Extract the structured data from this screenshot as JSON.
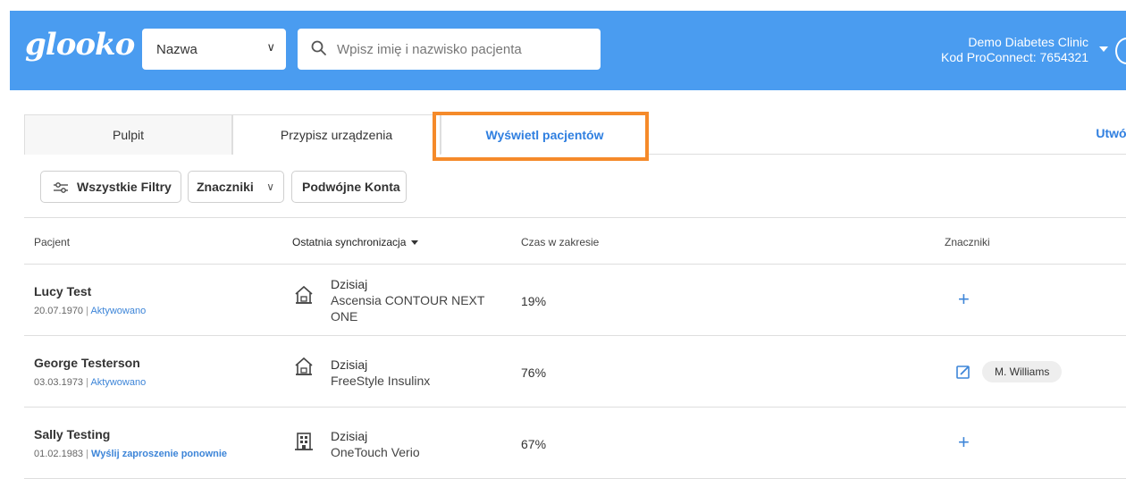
{
  "header": {
    "logo": "glooko",
    "select_value": "Nazwa",
    "search_placeholder": "Wpisz imię i nazwisko pacjenta",
    "clinic_name": "Demo Diabetes Clinic",
    "proconnect": "Kod ProConnect: 7654321"
  },
  "tabs": [
    {
      "label": "Pulpit"
    },
    {
      "label": "Przypisz urządzenia"
    },
    {
      "label": "Wyświetl pacjentów"
    }
  ],
  "create_link": "Utwór",
  "filters": {
    "all": "Wszystkie Filtry",
    "tags": "Znaczniki",
    "dual": "Podwójne Konta"
  },
  "columns": {
    "patient": "Pacjent",
    "last_sync": "Ostatnia synchronizacja",
    "time_in_range": "Czas w zakresie",
    "tags": "Znaczniki"
  },
  "rows": [
    {
      "name": "Lucy Test",
      "dob": "20.07.1970",
      "status": "Aktywowano",
      "sync_day": "Dzisiaj",
      "device_line1": "Ascensia CONTOUR NEXT",
      "device_line2": "ONE",
      "tir": "19%",
      "device_type": "home-icon"
    },
    {
      "name": "George Testerson",
      "dob": "03.03.1973",
      "status": "Aktywowano",
      "sync_day": "Dzisiaj",
      "device_line1": "FreeStyle Insulinx",
      "device_line2": "",
      "tir": "76%",
      "device_type": "home-icon",
      "tag": "M. Williams"
    },
    {
      "name": "Sally Testing",
      "dob": "01.02.1983",
      "status": "Wyślij zaproszenie ponownie",
      "sync_day": "Dzisiaj",
      "device_line1": "OneTouch Verio",
      "device_line2": "",
      "tir": "67%",
      "device_type": "clinic-building-icon"
    }
  ],
  "separator": "|",
  "colors": {
    "header": "#4a9cf0",
    "accent": "#2f7fe0",
    "highlight": "#f58a2a"
  }
}
